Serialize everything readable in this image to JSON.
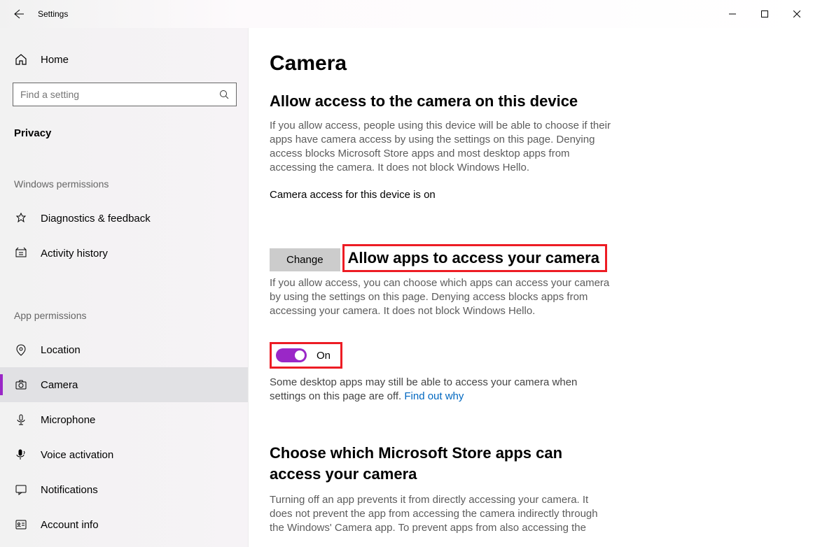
{
  "window": {
    "title": "Settings"
  },
  "sidebar": {
    "home_label": "Home",
    "search_placeholder": "Find a setting",
    "category": "Privacy",
    "groups": [
      {
        "label": "Windows permissions",
        "items": [
          {
            "icon": "diagnostics-icon",
            "label": "Diagnostics & feedback"
          },
          {
            "icon": "history-icon",
            "label": "Activity history"
          }
        ]
      },
      {
        "label": "App permissions",
        "items": [
          {
            "icon": "location-icon",
            "label": "Location"
          },
          {
            "icon": "camera-icon",
            "label": "Camera",
            "selected": true
          },
          {
            "icon": "microphone-icon",
            "label": "Microphone"
          },
          {
            "icon": "voice-icon",
            "label": "Voice activation"
          },
          {
            "icon": "notifications-icon",
            "label": "Notifications"
          },
          {
            "icon": "account-icon",
            "label": "Account info"
          }
        ]
      }
    ]
  },
  "content": {
    "page_title": "Camera",
    "section1": {
      "heading": "Allow access to the camera on this device",
      "desc": "If you allow access, people using this device will be able to choose if their apps have camera access by using the settings on this page. Denying access blocks Microsoft Store apps and most desktop apps from accessing the camera. It does not block Windows Hello.",
      "status": "Camera access for this device is on",
      "change_label": "Change"
    },
    "section2": {
      "heading": "Allow apps to access your camera",
      "desc": "If you allow access, you can choose which apps can access your camera by using the settings on this page. Denying access blocks apps from accessing your camera. It does not block Windows Hello.",
      "toggle_state": "On",
      "note_prefix": "Some desktop apps may still be able to access your camera when settings on this page are off. ",
      "note_link": "Find out why"
    },
    "section3": {
      "heading": "Choose which Microsoft Store apps can access your camera",
      "desc": "Turning off an app prevents it from directly accessing your camera. It does not prevent the app from accessing the camera indirectly through the Windows' Camera app. To prevent apps from also accessing the"
    }
  },
  "highlight_color": "#ed1c24",
  "accent_color": "#9a27c7"
}
